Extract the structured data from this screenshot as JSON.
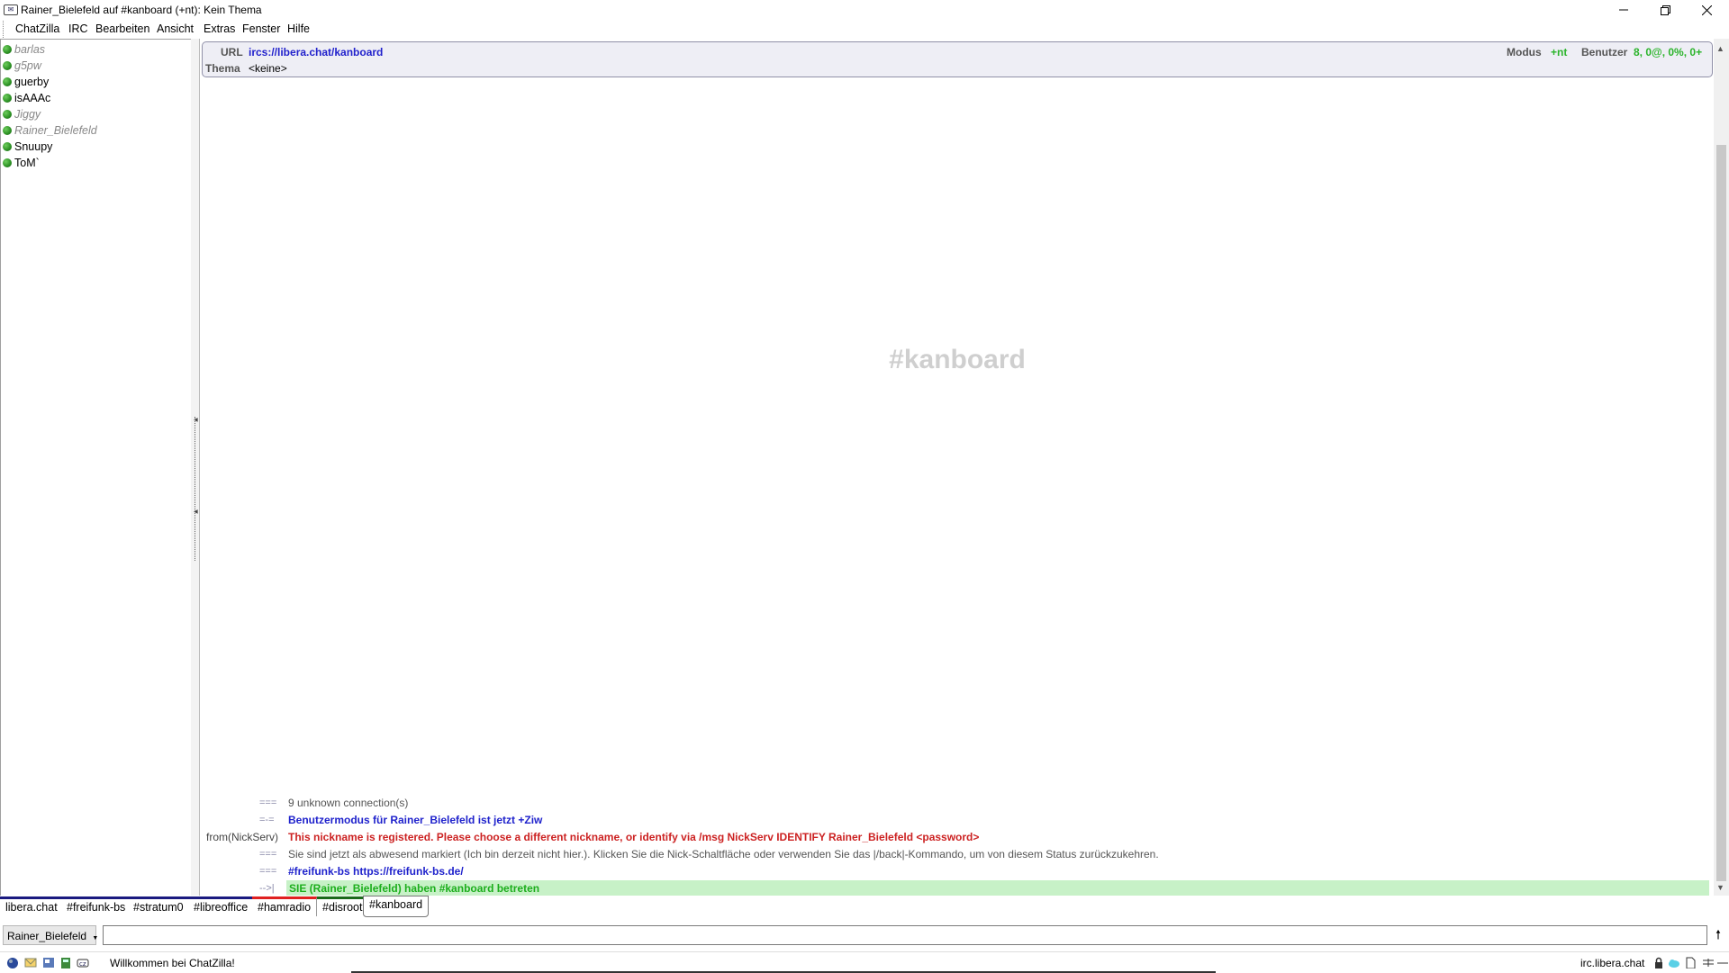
{
  "window": {
    "title": "Rainer_Bielefeld auf #kanboard (+nt): Kein Thema",
    "app_icon": "chatzilla-icon"
  },
  "menu": [
    "ChatZilla",
    "IRC",
    "Bearbeiten",
    "Ansicht",
    "Extras",
    "Fenster",
    "Hilfe"
  ],
  "userlist": [
    {
      "nick": "barlas",
      "away": true
    },
    {
      "nick": "g5pw",
      "away": true
    },
    {
      "nick": "guerby",
      "away": false
    },
    {
      "nick": "isAAAc",
      "away": false
    },
    {
      "nick": "Jiggy",
      "away": true
    },
    {
      "nick": "Rainer_Bielefeld",
      "away": true
    },
    {
      "nick": "Snuupy",
      "away": false
    },
    {
      "nick": "ToM`",
      "away": false
    }
  ],
  "header": {
    "url_label": "URL",
    "url_value": "ircs://libera.chat/kanboard",
    "topic_label": "Thema",
    "topic_value": "<keine>",
    "mode_label": "Modus",
    "mode_value": "+nt",
    "users_label": "Benutzer",
    "users_value": "8, 0@, 0%, 0+"
  },
  "channel_watermark": "#kanboard",
  "messages": [
    {
      "code": "===",
      "from": "",
      "text": "9 unknown connection(s)",
      "style": "gray"
    },
    {
      "code": "=-=",
      "from": "",
      "text": "Benutzermodus für Rainer_Bielefeld ist jetzt +Ziw",
      "style": "blue"
    },
    {
      "code": "",
      "from": "from(NickServ)",
      "text": "This nickname is registered. Please choose a different nickname, or identify via /msg NickServ IDENTIFY Rainer_Bielefeld <password>",
      "style": "red"
    },
    {
      "code": "===",
      "from": "",
      "text": "Sie sind jetzt als abwesend markiert (Ich bin derzeit nicht hier.). Klicken Sie die Nick-Schaltfläche oder verwenden Sie das |/back|-Kommando, um von diesem Status zurückzukehren.",
      "style": "gray"
    },
    {
      "code": "===",
      "from": "",
      "text": "#freifunk-bs https://freifunk-bs.de/",
      "style": "blue"
    },
    {
      "code": "-->|",
      "from": "",
      "text": "SIE (Rainer_Bielefeld) haben #kanboard betreten",
      "style": "green"
    }
  ],
  "tabs": [
    {
      "label": "libera.chat",
      "color": "#1a1a80"
    },
    {
      "label": "#freifunk-bs",
      "color": "#1a1a80"
    },
    {
      "label": "#stratum0",
      "color": "#1a1a80"
    },
    {
      "label": "#libreoffice",
      "color": "#1a1a80"
    },
    {
      "label": "#hamradio",
      "color": "#e02020"
    },
    {
      "label": "#disroot",
      "color": "#1a6a1a"
    },
    {
      "label": "#kanboard",
      "color": "#777777"
    }
  ],
  "input": {
    "nick_button": "Rainer_Bielefeld",
    "value": ""
  },
  "status": {
    "text": "Willkommen bei ChatZilla!",
    "server": "irc.libera.chat"
  }
}
